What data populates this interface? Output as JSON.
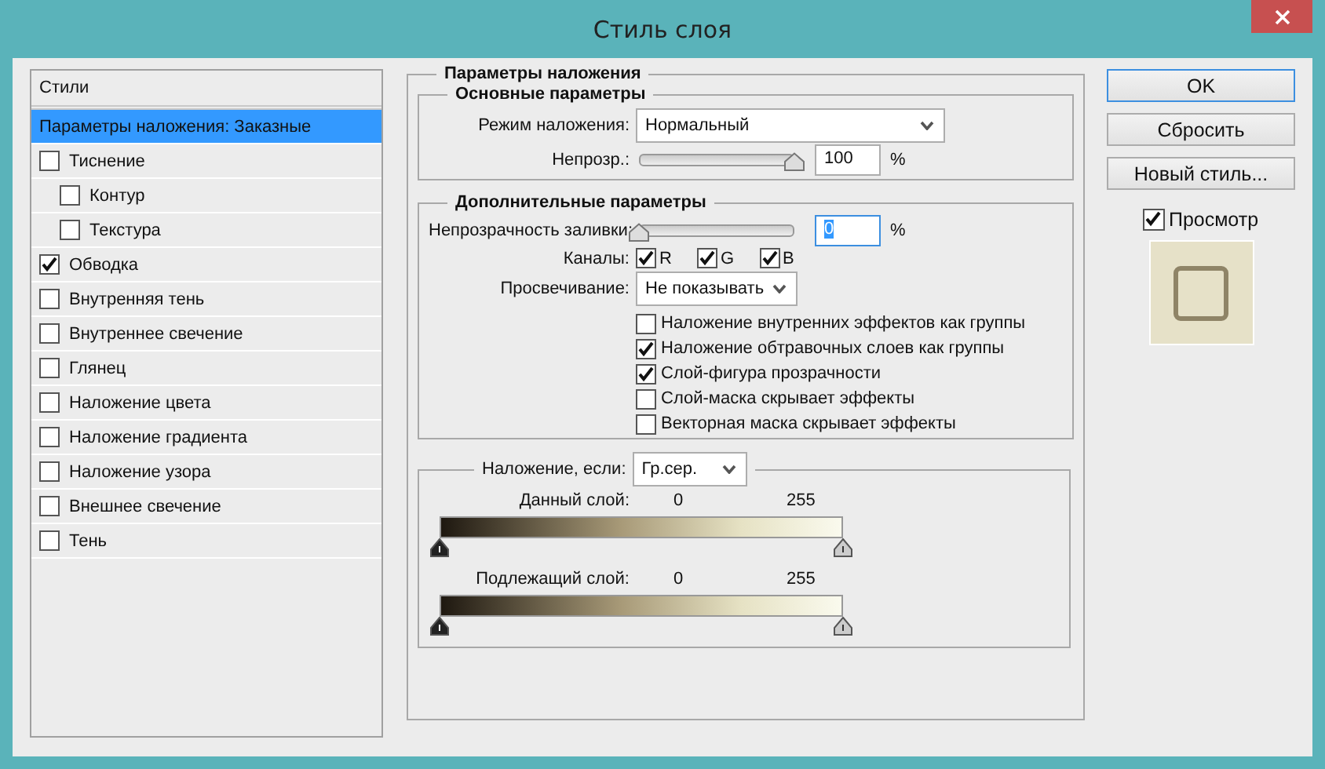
{
  "window": {
    "title": "Стиль слоя"
  },
  "styles": {
    "header": "Стили",
    "items": [
      {
        "label": "Параметры наложения: Заказные",
        "kind": "heading",
        "selected": true
      },
      {
        "label": "Тиснение",
        "kind": "check",
        "checked": false,
        "selected": false,
        "children": [
          {
            "label": "Контур",
            "kind": "check",
            "checked": false,
            "selected": false
          },
          {
            "label": "Текстура",
            "kind": "check",
            "checked": false,
            "selected": false
          }
        ]
      },
      {
        "label": "Обводка",
        "kind": "check",
        "checked": true,
        "selected": false
      },
      {
        "label": "Внутренняя тень",
        "kind": "check",
        "checked": false,
        "selected": false
      },
      {
        "label": "Внутреннее свечение",
        "kind": "check",
        "checked": false,
        "selected": false
      },
      {
        "label": "Глянец",
        "kind": "check",
        "checked": false,
        "selected": false
      },
      {
        "label": "Наложение цвета",
        "kind": "check",
        "checked": false,
        "selected": false
      },
      {
        "label": "Наложение градиента",
        "kind": "check",
        "checked": false,
        "selected": false
      },
      {
        "label": "Наложение узора",
        "kind": "check",
        "checked": false,
        "selected": false
      },
      {
        "label": "Внешнее свечение",
        "kind": "check",
        "checked": false,
        "selected": false
      },
      {
        "label": "Тень",
        "kind": "check",
        "checked": false,
        "selected": false
      }
    ]
  },
  "blending": {
    "title": "Параметры наложения",
    "general": {
      "title": "Основные параметры",
      "mode": {
        "label": "Режим наложения:",
        "value": "Нормальный"
      },
      "opacity": {
        "label": "Непрозр.:",
        "level": 1,
        "value": "100",
        "unit": "%"
      }
    },
    "advanced": {
      "title": "Дополнительные параметры",
      "fill": {
        "label": "Непрозрачность заливки:",
        "level": 0,
        "value": "0",
        "value_selected": true,
        "unit": "%"
      },
      "channels": {
        "label": "Каналы:",
        "items": [
          {
            "label": "R",
            "checked": true
          },
          {
            "label": "G",
            "checked": true
          },
          {
            "label": "B",
            "checked": true
          }
        ]
      },
      "knockout": {
        "label": "Просвечивание:",
        "value": "Не показывать"
      },
      "options": [
        {
          "label": "Наложение внутренних эффектов как группы",
          "checked": false
        },
        {
          "label": "Наложение обтравочных слоев как группы",
          "checked": true
        },
        {
          "label": "Слой-фигура прозрачности",
          "checked": true
        },
        {
          "label": "Слой-маска скрывает эффекты",
          "checked": false
        },
        {
          "label": "Векторная маска скрывает эффекты",
          "checked": false
        }
      ]
    },
    "blend_if": {
      "label": "Наложение, если:",
      "value": "Гр.сер.",
      "ranges": [
        {
          "label": "Данный слой:",
          "low": "0",
          "high": "255",
          "thumbs": [
            {
              "level": 0
            },
            {
              "level": 1
            }
          ]
        },
        {
          "label": "Подлежащий слой:",
          "low": "0",
          "high": "255",
          "thumbs": [
            {
              "level": 0
            },
            {
              "level": 1
            }
          ]
        }
      ]
    }
  },
  "side": {
    "buttons": [
      {
        "label": "OK",
        "default": true
      },
      {
        "label": "Сбросить",
        "default": false
      },
      {
        "label": "Новый стиль...",
        "default": false
      }
    ],
    "preview": {
      "label": "Просмотр",
      "checked": true
    }
  }
}
